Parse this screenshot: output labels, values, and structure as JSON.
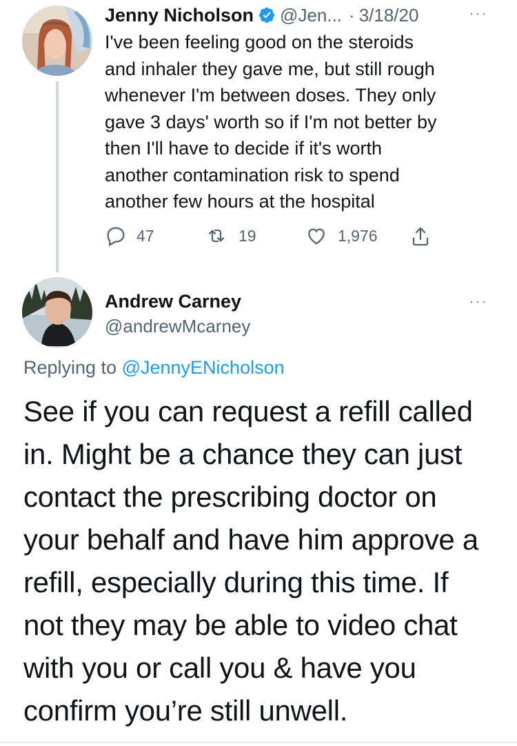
{
  "tweet1": {
    "name": "Jenny Nicholson",
    "handle": "@Jen...",
    "separator": "·",
    "date": "3/18/20",
    "text": "I've been feeling good on the steroids and inhaler they gave me, but still rough whenever I'm between doses. They only gave 3 days' worth so if I'm not better by then I'll have to decide if it's worth another contamination risk to spend another few hours at the hospital",
    "lines": [
      "I've been feeling good on the steroids",
      "and inhaler they gave me, but still rough",
      "whenever I'm between doses. They only",
      "gave 3 days' worth so if I'm not better by",
      "then I'll have to decide if it's worth",
      "another contamination risk to spend",
      "another few hours at the hospital"
    ],
    "replies": "47",
    "retweets": "19",
    "likes": "1,976",
    "more": "···"
  },
  "tweet2": {
    "name": "Andrew Carney",
    "handle": "@andrewMcarney",
    "more": "···",
    "replying_prefix": "Replying to ",
    "replying_to": "@JennyENicholson",
    "lines": [
      "See if you can request a refill called",
      "in. Might be a chance they can just",
      "contact the prescribing doctor on",
      "your behalf and have him approve a",
      "refill, especially during this time. If",
      "not they may be able to video chat",
      "with you or call you & have you",
      "confirm you’re still unwell."
    ]
  },
  "colors": {
    "accent": "#1d9bf0",
    "muted": "#536471",
    "text": "#0f1419",
    "thread_line": "#cfd9de"
  },
  "icons": {
    "verified": "verified-badge-icon",
    "reply": "reply-icon",
    "retweet": "retweet-icon",
    "like": "heart-icon",
    "share": "share-icon",
    "more": "more-icon"
  }
}
